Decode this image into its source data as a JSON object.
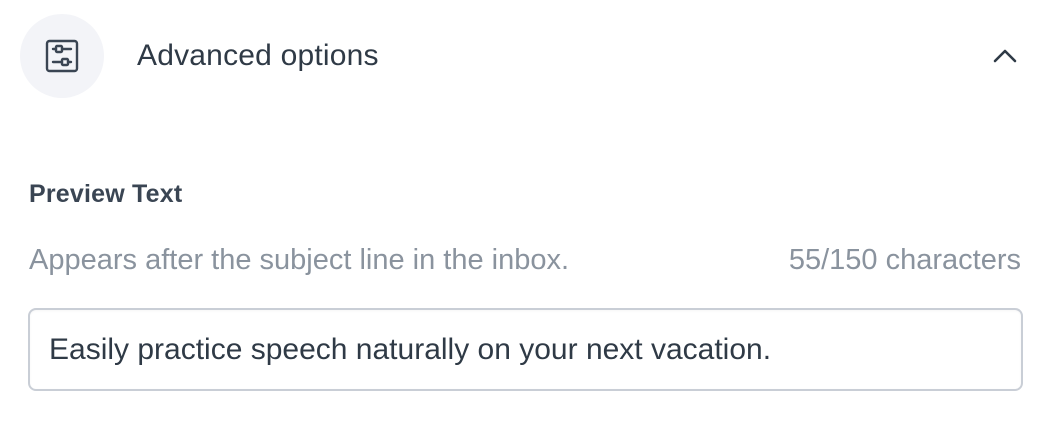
{
  "advanced": {
    "title": "Advanced options",
    "icon": "sliders-icon",
    "toggle_icon": "chevron-up-icon",
    "expanded": true
  },
  "preview": {
    "label": "Preview Text",
    "helper": "Appears after the subject line in the inbox.",
    "count": "55/150 characters",
    "value": "Easily practice speech naturally on your next vacation."
  },
  "colors": {
    "icon_bg": "#f3f4f8",
    "text": "#2f3a46",
    "muted": "#8a939e",
    "input_border": "#c9ced6"
  }
}
